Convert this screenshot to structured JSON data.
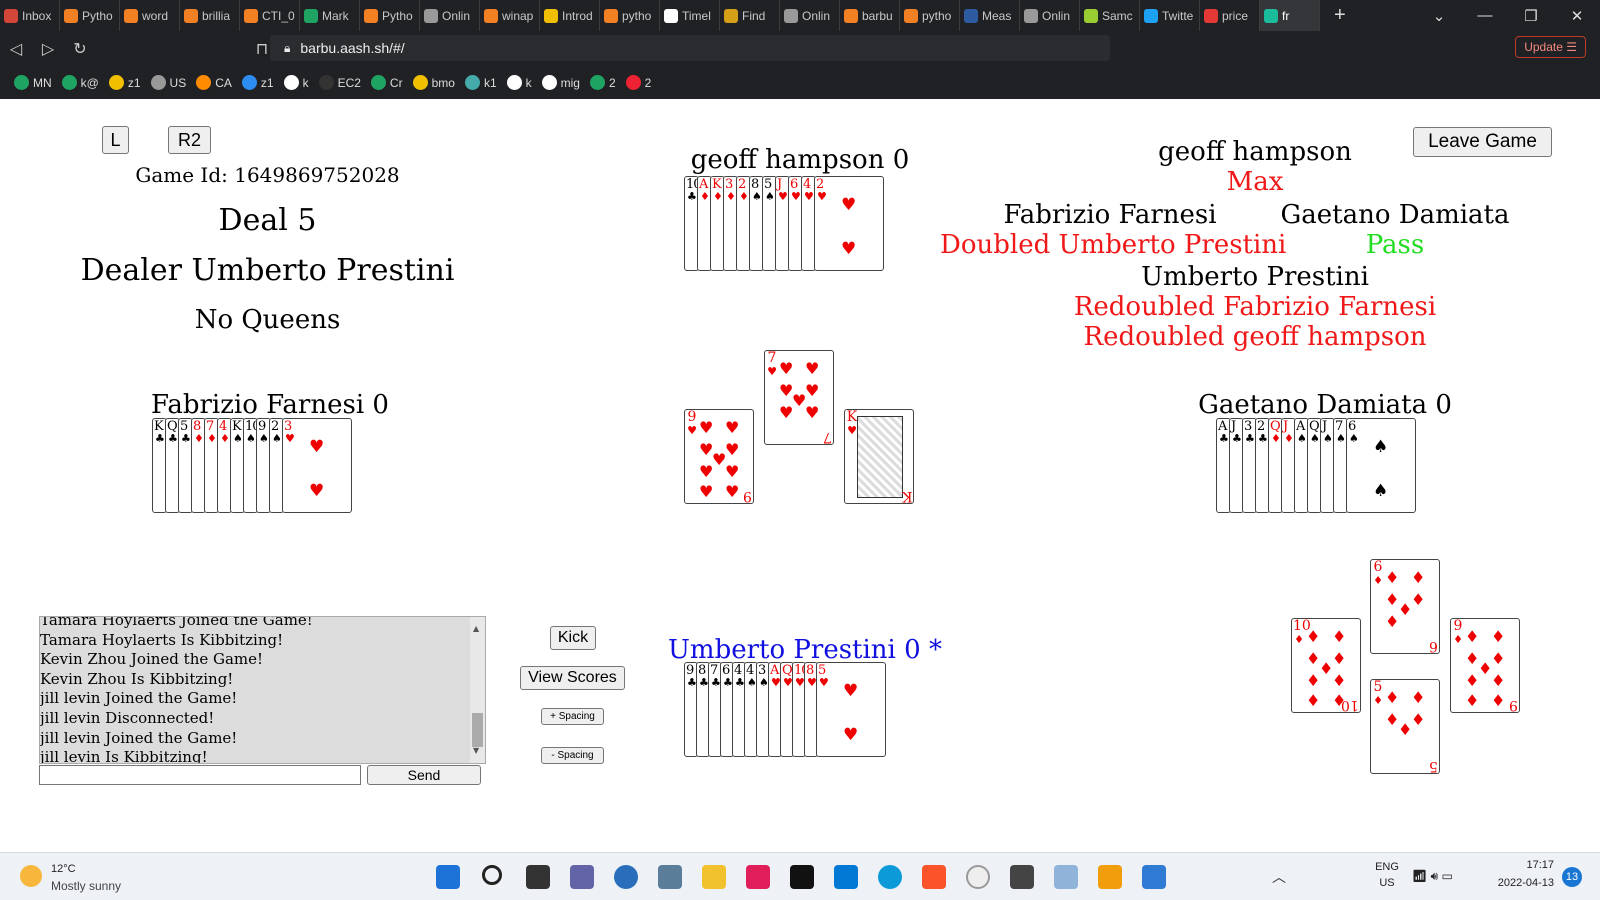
{
  "browser": {
    "tabs": [
      {
        "label": "Inbox",
        "color": "#d44638"
      },
      {
        "label": "Pytho",
        "color": "#f48024"
      },
      {
        "label": "word",
        "color": "#f48024"
      },
      {
        "label": "brillia",
        "color": "#f48024"
      },
      {
        "label": "CTI_0",
        "color": "#f48024"
      },
      {
        "label": "Mark",
        "color": "#1ea362"
      },
      {
        "label": "Pytho",
        "color": "#f48024"
      },
      {
        "label": "Onlin",
        "color": "#999"
      },
      {
        "label": "winap",
        "color": "#f48024"
      },
      {
        "label": "Introd",
        "color": "#f0c000"
      },
      {
        "label": "pytho",
        "color": "#f48024"
      },
      {
        "label": "Timel",
        "color": "#fff"
      },
      {
        "label": "Find",
        "color": "#d4a017"
      },
      {
        "label": "Onlin",
        "color": "#999"
      },
      {
        "label": "barbu",
        "color": "#f48024"
      },
      {
        "label": "pytho",
        "color": "#f48024"
      },
      {
        "label": "Meas",
        "color": "#2d5aa0"
      },
      {
        "label": "Onlin",
        "color": "#999"
      },
      {
        "label": "Samc",
        "color": "#9acd32"
      },
      {
        "label": "Twitte",
        "color": "#1da1f2"
      },
      {
        "label": "price",
        "color": "#e53935"
      },
      {
        "label": "fr",
        "color": "#1abc9c"
      }
    ],
    "url": "barbu.aash.sh/#/",
    "update_label": "Update",
    "bookmarks": [
      "MN",
      "k@",
      "z1",
      "US",
      "CA",
      "z1",
      "k",
      "EC2",
      "Cr",
      "bmo",
      "k1",
      "k",
      "mig",
      "2",
      "2"
    ]
  },
  "controls": {
    "l_label": "L",
    "r2_label": "R2",
    "leave_label": "Leave Game",
    "kick_label": "Kick",
    "scores_label": "View Scores",
    "plus_spacing": "+ Spacing",
    "minus_spacing": "- Spacing",
    "send_label": "Send"
  },
  "info": {
    "game_id": "Game Id: 1649869752028",
    "deal": "Deal 5",
    "dealer": "Dealer Umberto Prestini",
    "contract": "No Queens"
  },
  "players": {
    "north": "geoff hampson 0",
    "west": "Fabrizio Farnesi 0",
    "east": "Gaetano Damiata 0",
    "south": "Umberto Prestini 0 *"
  },
  "bidding": {
    "p1_name": "geoff hampson",
    "p1_action": "Max",
    "p2_name": "Fabrizio Farnesi",
    "p2_action": "Doubled Umberto Prestini",
    "p3_name": "Gaetano Damiata",
    "p3_action": "Pass",
    "p4_name": "Umberto Prestini",
    "p4_action1": "Redoubled Fabrizio Farnesi",
    "p4_action2": "Redoubled geoff hampson",
    "colors": {
      "red": "#f01818",
      "green": "#22dd22"
    }
  },
  "hands": {
    "north": [
      [
        "10",
        "♣",
        "b"
      ],
      [
        "A",
        "♦",
        "r"
      ],
      [
        "K",
        "♦",
        "r"
      ],
      [
        "3",
        "♦",
        "r"
      ],
      [
        "2",
        "♦",
        "r"
      ],
      [
        "8",
        "♠",
        "b"
      ],
      [
        "5",
        "♠",
        "b"
      ],
      [
        "J",
        "♥",
        "r"
      ],
      [
        "6",
        "♥",
        "r"
      ],
      [
        "4",
        "♥",
        "r"
      ],
      [
        "2",
        "♥",
        "r"
      ]
    ],
    "west": [
      [
        "K",
        "♣",
        "b"
      ],
      [
        "Q",
        "♣",
        "b"
      ],
      [
        "5",
        "♣",
        "b"
      ],
      [
        "8",
        "♦",
        "r"
      ],
      [
        "7",
        "♦",
        "r"
      ],
      [
        "4",
        "♦",
        "r"
      ],
      [
        "K",
        "♠",
        "b"
      ],
      [
        "10",
        "♠",
        "b"
      ],
      [
        "9",
        "♠",
        "b"
      ],
      [
        "2",
        "♠",
        "b"
      ],
      [
        "3",
        "♥",
        "r"
      ]
    ],
    "east": [
      [
        "A",
        "♣",
        "b"
      ],
      [
        "J",
        "♣",
        "b"
      ],
      [
        "3",
        "♣",
        "b"
      ],
      [
        "2",
        "♣",
        "b"
      ],
      [
        "Q",
        "♦",
        "r"
      ],
      [
        "J",
        "♦",
        "r"
      ],
      [
        "A",
        "♠",
        "b"
      ],
      [
        "Q",
        "♠",
        "b"
      ],
      [
        "J",
        "♠",
        "b"
      ],
      [
        "7",
        "♠",
        "b"
      ],
      [
        "6",
        "♠",
        "b"
      ]
    ],
    "south": [
      [
        "9",
        "♣",
        "b"
      ],
      [
        "8",
        "♣",
        "b"
      ],
      [
        "7",
        "♣",
        "b"
      ],
      [
        "6",
        "♣",
        "b"
      ],
      [
        "4",
        "♣",
        "b"
      ],
      [
        "4",
        "♠",
        "b"
      ],
      [
        "3",
        "♠",
        "b"
      ],
      [
        "A",
        "♥",
        "r"
      ],
      [
        "Q",
        "♥",
        "r"
      ],
      [
        "10",
        "♥",
        "r"
      ],
      [
        "8",
        "♥",
        "r"
      ],
      [
        "5",
        "♥",
        "r"
      ]
    ]
  },
  "trick": {
    "north": [
      "7",
      "♥"
    ],
    "west": [
      "9",
      "♥"
    ],
    "east": [
      "K",
      "♥"
    ]
  },
  "last_trick": {
    "north": [
      "6",
      "♦"
    ],
    "west": [
      "10",
      "♦"
    ],
    "east": [
      "9",
      "♦"
    ],
    "south": [
      "5",
      "♦"
    ]
  },
  "chat": {
    "lines": [
      "Tamara Hoylaerts Joined the Game!",
      "Tamara Hoylaerts Is Kibbitzing!",
      "Kevin Zhou Joined the Game!",
      "Kevin Zhou Is Kibbitzing!",
      "jill levin Joined the Game!",
      "jill levin Disconnected!",
      "jill levin Joined the Game!",
      "jill levin Is Kibbitzing!"
    ]
  },
  "taskbar": {
    "temp": "12°C",
    "weather": "Mostly sunny",
    "lang1": "ENG",
    "lang2": "US",
    "time": "17:17",
    "date": "2022-04-13",
    "notif": "13"
  }
}
